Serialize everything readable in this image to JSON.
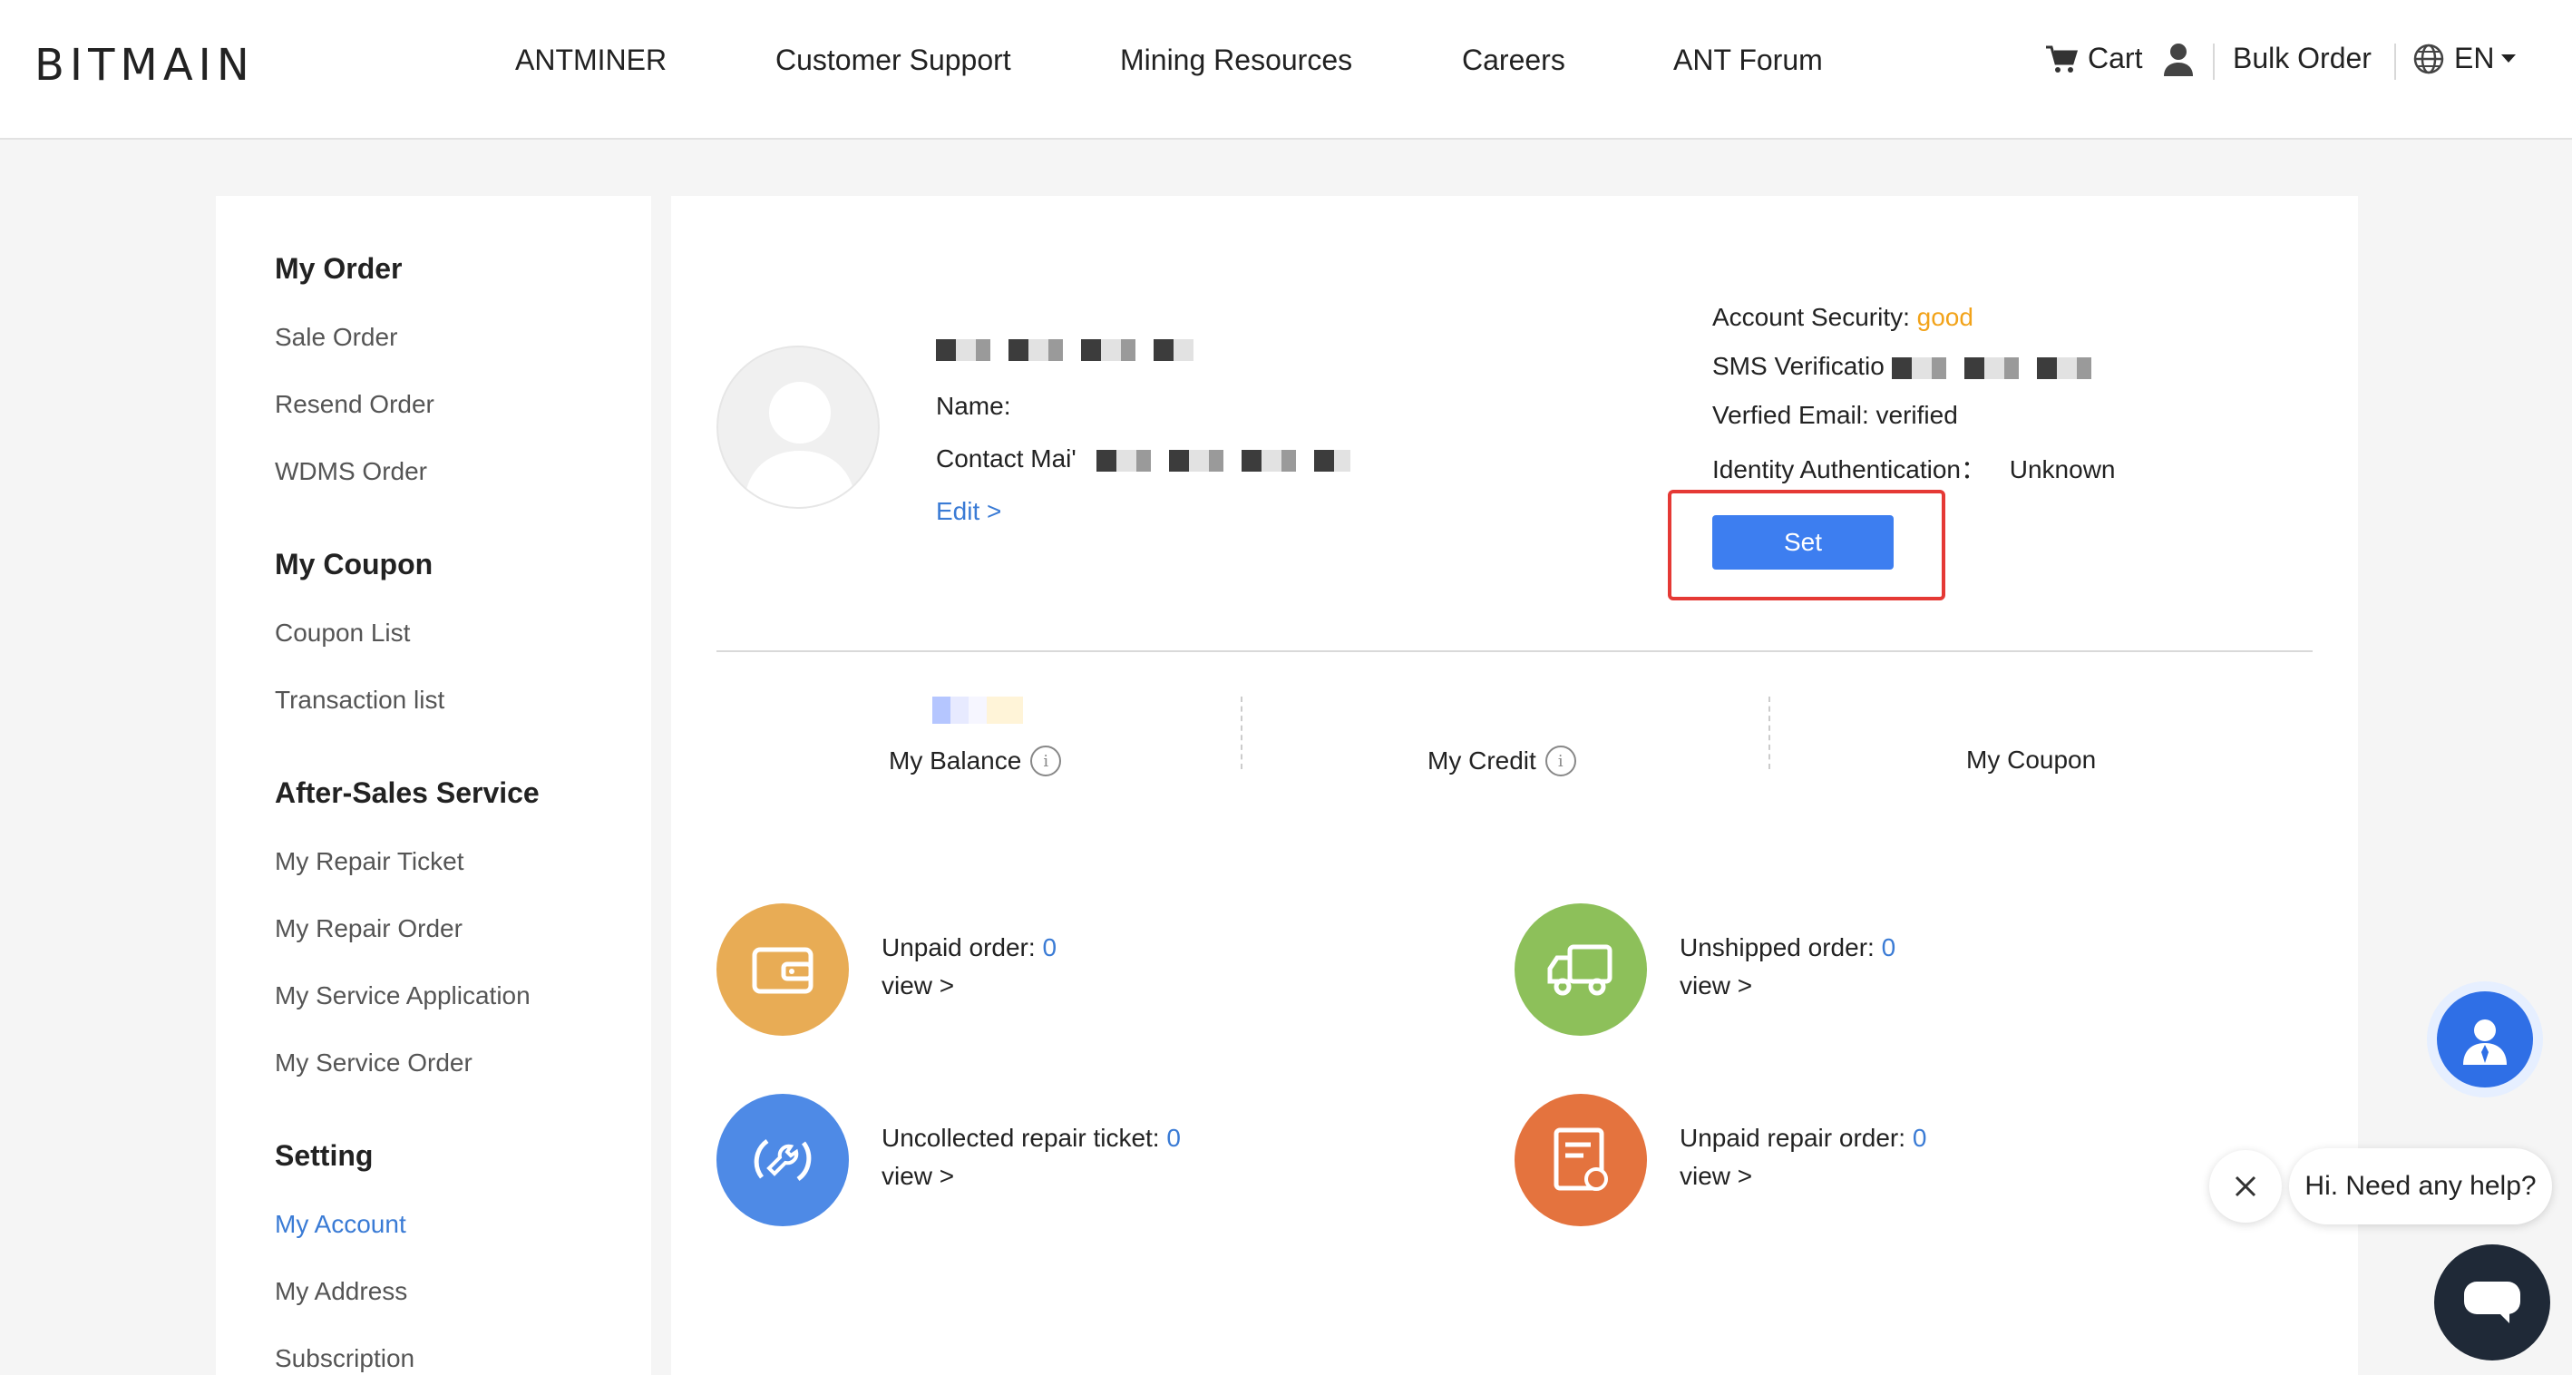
{
  "header": {
    "logo": "BITMAIN",
    "nav": [
      "ANTMINER",
      "Customer Support",
      "Mining Resources",
      "Careers",
      "ANT Forum"
    ],
    "cart_label": "Cart",
    "bulk_order_label": "Bulk Order",
    "language_label": "EN"
  },
  "sidebar": {
    "groups": [
      {
        "title": "My Order",
        "items": [
          "Sale Order",
          "Resend Order",
          "WDMS Order"
        ]
      },
      {
        "title": "My Coupon",
        "items": [
          "Coupon List",
          "Transaction list"
        ]
      },
      {
        "title": "After-Sales Service",
        "items": [
          "My Repair Ticket",
          "My Repair Order",
          "My Service Application",
          "My Service Order"
        ]
      },
      {
        "title": "Setting",
        "items": [
          "My Account",
          "My Address",
          "Subscription"
        ]
      }
    ],
    "active_item": "My Account"
  },
  "profile": {
    "name_label": "Name:",
    "contact_label": "Contact Mai'",
    "edit_link": "Edit >"
  },
  "security": {
    "account_security_label": "Account Security:",
    "account_security_value": "good",
    "sms_label": "SMS Verificatio",
    "email_label": "Verfied Email:",
    "email_value": "verified",
    "identity_label": "Identity Authentication：",
    "identity_value": "Unknown",
    "set_button": "Set"
  },
  "stats": {
    "balance_label": "My Balance",
    "credit_label": "My Credit",
    "coupon_label": "My Coupon"
  },
  "orders": {
    "unpaid_label": "Unpaid order:",
    "unpaid_count": "0",
    "unshipped_label": "Unshipped order:",
    "unshipped_count": "0",
    "uncollected_label": "Uncollected repair ticket:",
    "uncollected_count": "0",
    "unpaid_repair_label": "Unpaid repair order:",
    "unpaid_repair_count": "0",
    "view_label": "view >"
  },
  "chat": {
    "help_text": "Hi. Need any help?"
  },
  "colors": {
    "accent_blue": "#3d7ef0",
    "link_blue": "#3a7bd5",
    "good_orange": "#f2a31a",
    "highlight_red": "#e53935",
    "unpaid_icon": "#e8ac55",
    "unshipped_icon": "#8dc05a",
    "repair_ticket_icon": "#4e8ae6",
    "repair_order_icon": "#e4733e"
  }
}
